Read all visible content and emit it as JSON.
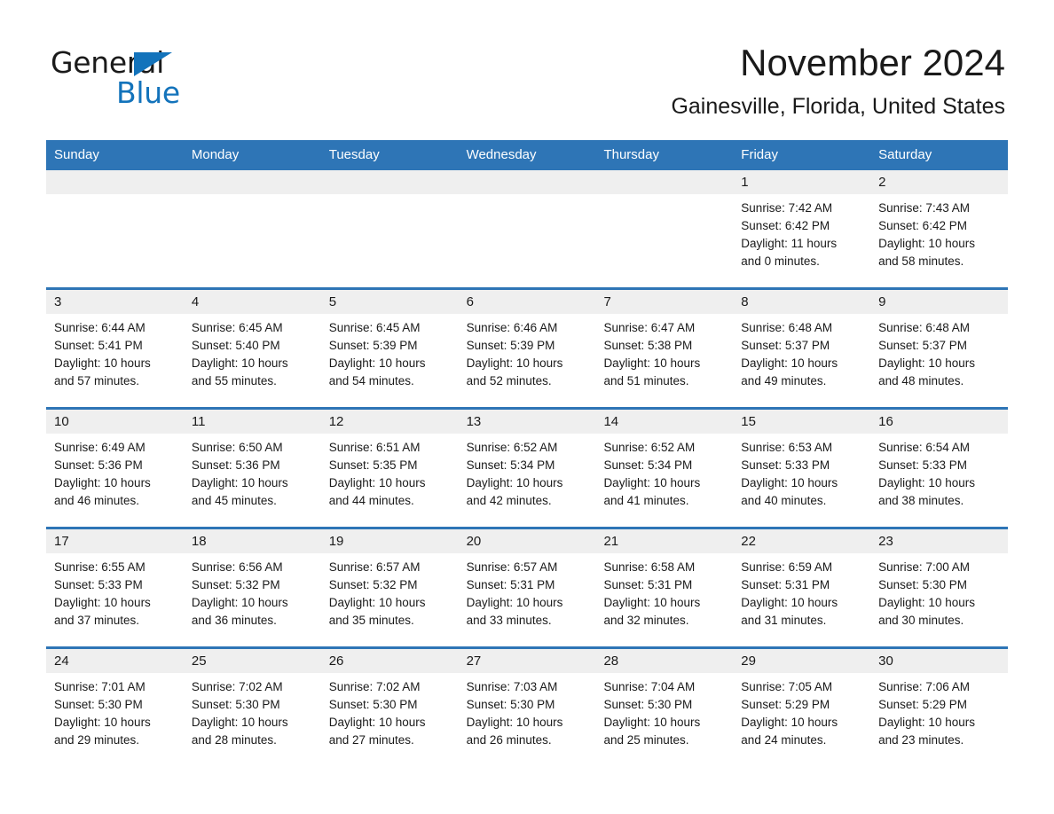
{
  "brand": {
    "name_part1": "General",
    "name_part2": "Blue",
    "triangle_icon": "triangle-icon",
    "accent_color": "#1373bb"
  },
  "header": {
    "month_title": "November 2024",
    "location": "Gainesville, Florida, United States"
  },
  "theme": {
    "header_blue": "#2e75b6",
    "band_gray": "#efefef",
    "text_color": "#1a1a1a"
  },
  "calendar": {
    "weekday_headers": [
      "Sunday",
      "Monday",
      "Tuesday",
      "Wednesday",
      "Thursday",
      "Friday",
      "Saturday"
    ],
    "labels": {
      "sunrise_prefix": "Sunrise:",
      "sunset_prefix": "Sunset:",
      "daylight_prefix": "Daylight:"
    },
    "weeks": [
      [
        {
          "day": "",
          "empty": true
        },
        {
          "day": "",
          "empty": true
        },
        {
          "day": "",
          "empty": true
        },
        {
          "day": "",
          "empty": true
        },
        {
          "day": "",
          "empty": true
        },
        {
          "day": "1",
          "sunrise": "Sunrise: 7:42 AM",
          "sunset": "Sunset: 6:42 PM",
          "daylight_line1": "Daylight: 11 hours",
          "daylight_line2": "and 0 minutes."
        },
        {
          "day": "2",
          "sunrise": "Sunrise: 7:43 AM",
          "sunset": "Sunset: 6:42 PM",
          "daylight_line1": "Daylight: 10 hours",
          "daylight_line2": "and 58 minutes."
        }
      ],
      [
        {
          "day": "3",
          "sunrise": "Sunrise: 6:44 AM",
          "sunset": "Sunset: 5:41 PM",
          "daylight_line1": "Daylight: 10 hours",
          "daylight_line2": "and 57 minutes."
        },
        {
          "day": "4",
          "sunrise": "Sunrise: 6:45 AM",
          "sunset": "Sunset: 5:40 PM",
          "daylight_line1": "Daylight: 10 hours",
          "daylight_line2": "and 55 minutes."
        },
        {
          "day": "5",
          "sunrise": "Sunrise: 6:45 AM",
          "sunset": "Sunset: 5:39 PM",
          "daylight_line1": "Daylight: 10 hours",
          "daylight_line2": "and 54 minutes."
        },
        {
          "day": "6",
          "sunrise": "Sunrise: 6:46 AM",
          "sunset": "Sunset: 5:39 PM",
          "daylight_line1": "Daylight: 10 hours",
          "daylight_line2": "and 52 minutes."
        },
        {
          "day": "7",
          "sunrise": "Sunrise: 6:47 AM",
          "sunset": "Sunset: 5:38 PM",
          "daylight_line1": "Daylight: 10 hours",
          "daylight_line2": "and 51 minutes."
        },
        {
          "day": "8",
          "sunrise": "Sunrise: 6:48 AM",
          "sunset": "Sunset: 5:37 PM",
          "daylight_line1": "Daylight: 10 hours",
          "daylight_line2": "and 49 minutes."
        },
        {
          "day": "9",
          "sunrise": "Sunrise: 6:48 AM",
          "sunset": "Sunset: 5:37 PM",
          "daylight_line1": "Daylight: 10 hours",
          "daylight_line2": "and 48 minutes."
        }
      ],
      [
        {
          "day": "10",
          "sunrise": "Sunrise: 6:49 AM",
          "sunset": "Sunset: 5:36 PM",
          "daylight_line1": "Daylight: 10 hours",
          "daylight_line2": "and 46 minutes."
        },
        {
          "day": "11",
          "sunrise": "Sunrise: 6:50 AM",
          "sunset": "Sunset: 5:36 PM",
          "daylight_line1": "Daylight: 10 hours",
          "daylight_line2": "and 45 minutes."
        },
        {
          "day": "12",
          "sunrise": "Sunrise: 6:51 AM",
          "sunset": "Sunset: 5:35 PM",
          "daylight_line1": "Daylight: 10 hours",
          "daylight_line2": "and 44 minutes."
        },
        {
          "day": "13",
          "sunrise": "Sunrise: 6:52 AM",
          "sunset": "Sunset: 5:34 PM",
          "daylight_line1": "Daylight: 10 hours",
          "daylight_line2": "and 42 minutes."
        },
        {
          "day": "14",
          "sunrise": "Sunrise: 6:52 AM",
          "sunset": "Sunset: 5:34 PM",
          "daylight_line1": "Daylight: 10 hours",
          "daylight_line2": "and 41 minutes."
        },
        {
          "day": "15",
          "sunrise": "Sunrise: 6:53 AM",
          "sunset": "Sunset: 5:33 PM",
          "daylight_line1": "Daylight: 10 hours",
          "daylight_line2": "and 40 minutes."
        },
        {
          "day": "16",
          "sunrise": "Sunrise: 6:54 AM",
          "sunset": "Sunset: 5:33 PM",
          "daylight_line1": "Daylight: 10 hours",
          "daylight_line2": "and 38 minutes."
        }
      ],
      [
        {
          "day": "17",
          "sunrise": "Sunrise: 6:55 AM",
          "sunset": "Sunset: 5:33 PM",
          "daylight_line1": "Daylight: 10 hours",
          "daylight_line2": "and 37 minutes."
        },
        {
          "day": "18",
          "sunrise": "Sunrise: 6:56 AM",
          "sunset": "Sunset: 5:32 PM",
          "daylight_line1": "Daylight: 10 hours",
          "daylight_line2": "and 36 minutes."
        },
        {
          "day": "19",
          "sunrise": "Sunrise: 6:57 AM",
          "sunset": "Sunset: 5:32 PM",
          "daylight_line1": "Daylight: 10 hours",
          "daylight_line2": "and 35 minutes."
        },
        {
          "day": "20",
          "sunrise": "Sunrise: 6:57 AM",
          "sunset": "Sunset: 5:31 PM",
          "daylight_line1": "Daylight: 10 hours",
          "daylight_line2": "and 33 minutes."
        },
        {
          "day": "21",
          "sunrise": "Sunrise: 6:58 AM",
          "sunset": "Sunset: 5:31 PM",
          "daylight_line1": "Daylight: 10 hours",
          "daylight_line2": "and 32 minutes."
        },
        {
          "day": "22",
          "sunrise": "Sunrise: 6:59 AM",
          "sunset": "Sunset: 5:31 PM",
          "daylight_line1": "Daylight: 10 hours",
          "daylight_line2": "and 31 minutes."
        },
        {
          "day": "23",
          "sunrise": "Sunrise: 7:00 AM",
          "sunset": "Sunset: 5:30 PM",
          "daylight_line1": "Daylight: 10 hours",
          "daylight_line2": "and 30 minutes."
        }
      ],
      [
        {
          "day": "24",
          "sunrise": "Sunrise: 7:01 AM",
          "sunset": "Sunset: 5:30 PM",
          "daylight_line1": "Daylight: 10 hours",
          "daylight_line2": "and 29 minutes."
        },
        {
          "day": "25",
          "sunrise": "Sunrise: 7:02 AM",
          "sunset": "Sunset: 5:30 PM",
          "daylight_line1": "Daylight: 10 hours",
          "daylight_line2": "and 28 minutes."
        },
        {
          "day": "26",
          "sunrise": "Sunrise: 7:02 AM",
          "sunset": "Sunset: 5:30 PM",
          "daylight_line1": "Daylight: 10 hours",
          "daylight_line2": "and 27 minutes."
        },
        {
          "day": "27",
          "sunrise": "Sunrise: 7:03 AM",
          "sunset": "Sunset: 5:30 PM",
          "daylight_line1": "Daylight: 10 hours",
          "daylight_line2": "and 26 minutes."
        },
        {
          "day": "28",
          "sunrise": "Sunrise: 7:04 AM",
          "sunset": "Sunset: 5:30 PM",
          "daylight_line1": "Daylight: 10 hours",
          "daylight_line2": "and 25 minutes."
        },
        {
          "day": "29",
          "sunrise": "Sunrise: 7:05 AM",
          "sunset": "Sunset: 5:29 PM",
          "daylight_line1": "Daylight: 10 hours",
          "daylight_line2": "and 24 minutes."
        },
        {
          "day": "30",
          "sunrise": "Sunrise: 7:06 AM",
          "sunset": "Sunset: 5:29 PM",
          "daylight_line1": "Daylight: 10 hours",
          "daylight_line2": "and 23 minutes."
        }
      ]
    ]
  }
}
